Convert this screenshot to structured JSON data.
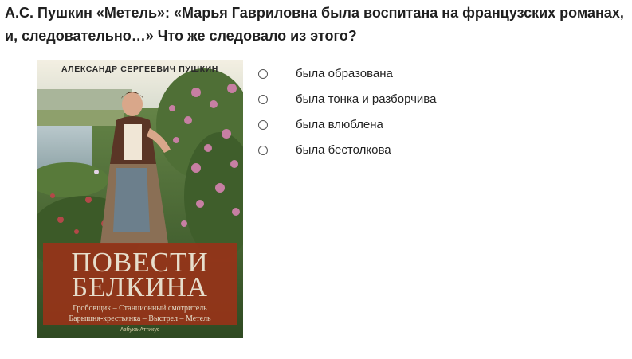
{
  "question": {
    "title": "А.С. Пушкин «Метель»: «Марья Гавриловна была воспитана на французских романах, и, следовательно…» Что же следовало из этого?"
  },
  "cover": {
    "author": "АЛЕКСАНДР СЕРГЕЕВИЧ ПУШКИН",
    "title_line1": "ПОВЕСТИ",
    "title_line2": "БЕЛКИНА",
    "subtitle_line1": "Гробовщик – Станционный смотритель",
    "subtitle_line2": "Барышня-крестьянка – Выстрел – Метель",
    "publisher": "Азбука-Аттикус",
    "accent_color": "#963419"
  },
  "answers": [
    {
      "label": "была образована"
    },
    {
      "label": "была тонка и разборчива"
    },
    {
      "label": "была влюблена"
    },
    {
      "label": "была бестолкова"
    }
  ]
}
